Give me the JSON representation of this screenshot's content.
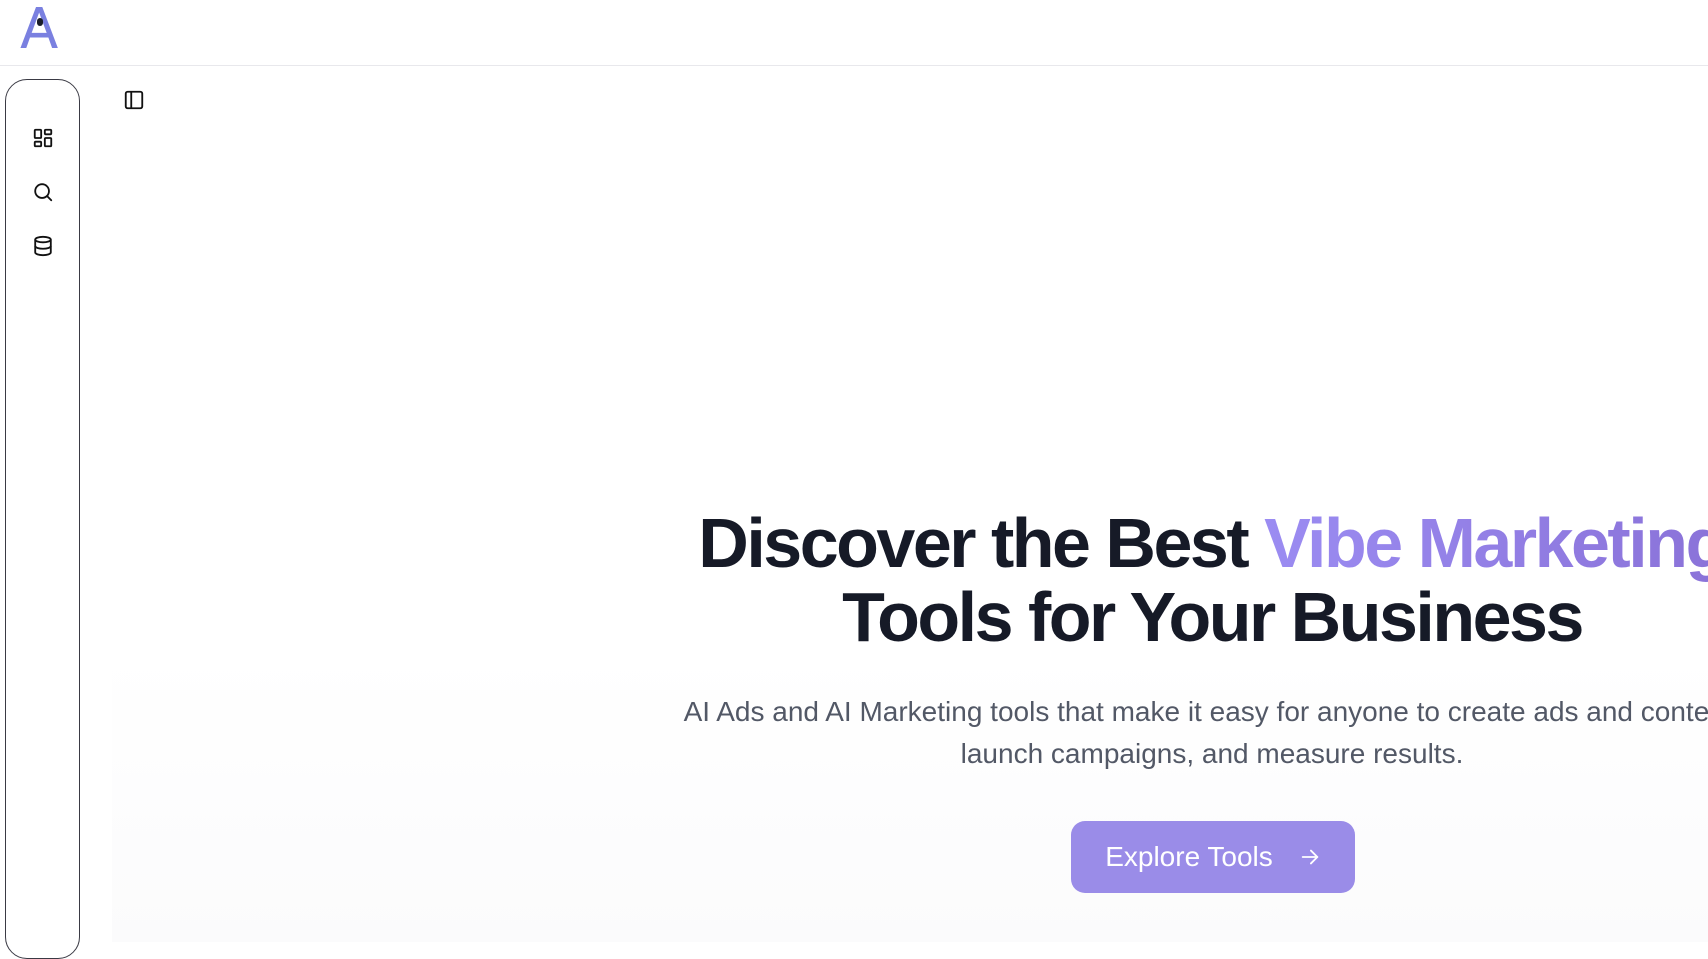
{
  "app": {
    "logo_text": "A",
    "brand_color": "#7a80e0"
  },
  "sidebar": {
    "items": [
      {
        "icon": "dashboard-icon"
      },
      {
        "icon": "search-icon"
      },
      {
        "icon": "database-icon"
      }
    ],
    "toggle_icon": "sidebar-toggle-icon"
  },
  "hero": {
    "title_part1": "Discover the Best ",
    "title_accent": "Vibe Marketing",
    "title_part2": "Tools for Your Business",
    "subtitle_line1": "AI Ads and AI Marketing tools that make it easy for anyone to create ads and content,",
    "subtitle_line2": "launch campaigns, and measure results.",
    "cta_label": "Explore Tools",
    "cta_icon": "arrow-right-icon",
    "accent_color": "#9b8cf2",
    "cta_color": "#9a8ce8"
  }
}
